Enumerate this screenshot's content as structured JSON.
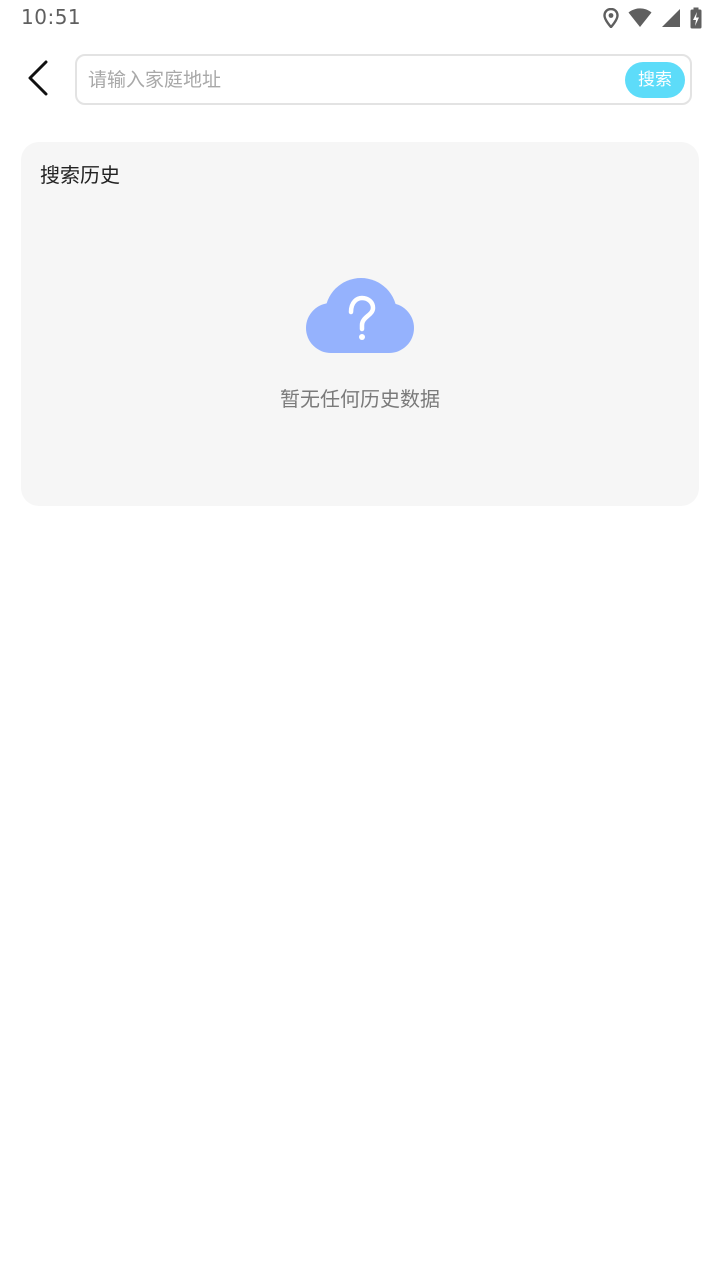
{
  "status_bar": {
    "time": "10:51",
    "icons": [
      "location-icon",
      "wifi-icon",
      "signal-icon",
      "battery-charging-icon"
    ]
  },
  "header": {
    "back_icon": "chevron-left-icon",
    "search_placeholder": "请输入家庭地址",
    "search_value": "",
    "search_button_label": "搜索"
  },
  "history": {
    "title": "搜索历史",
    "empty_icon": "cloud-question-icon",
    "empty_text": "暂无任何历史数据"
  },
  "colors": {
    "accent": "#5ddcf9",
    "empty_icon": "#95b2fd",
    "card_background": "#f6f6f6"
  }
}
